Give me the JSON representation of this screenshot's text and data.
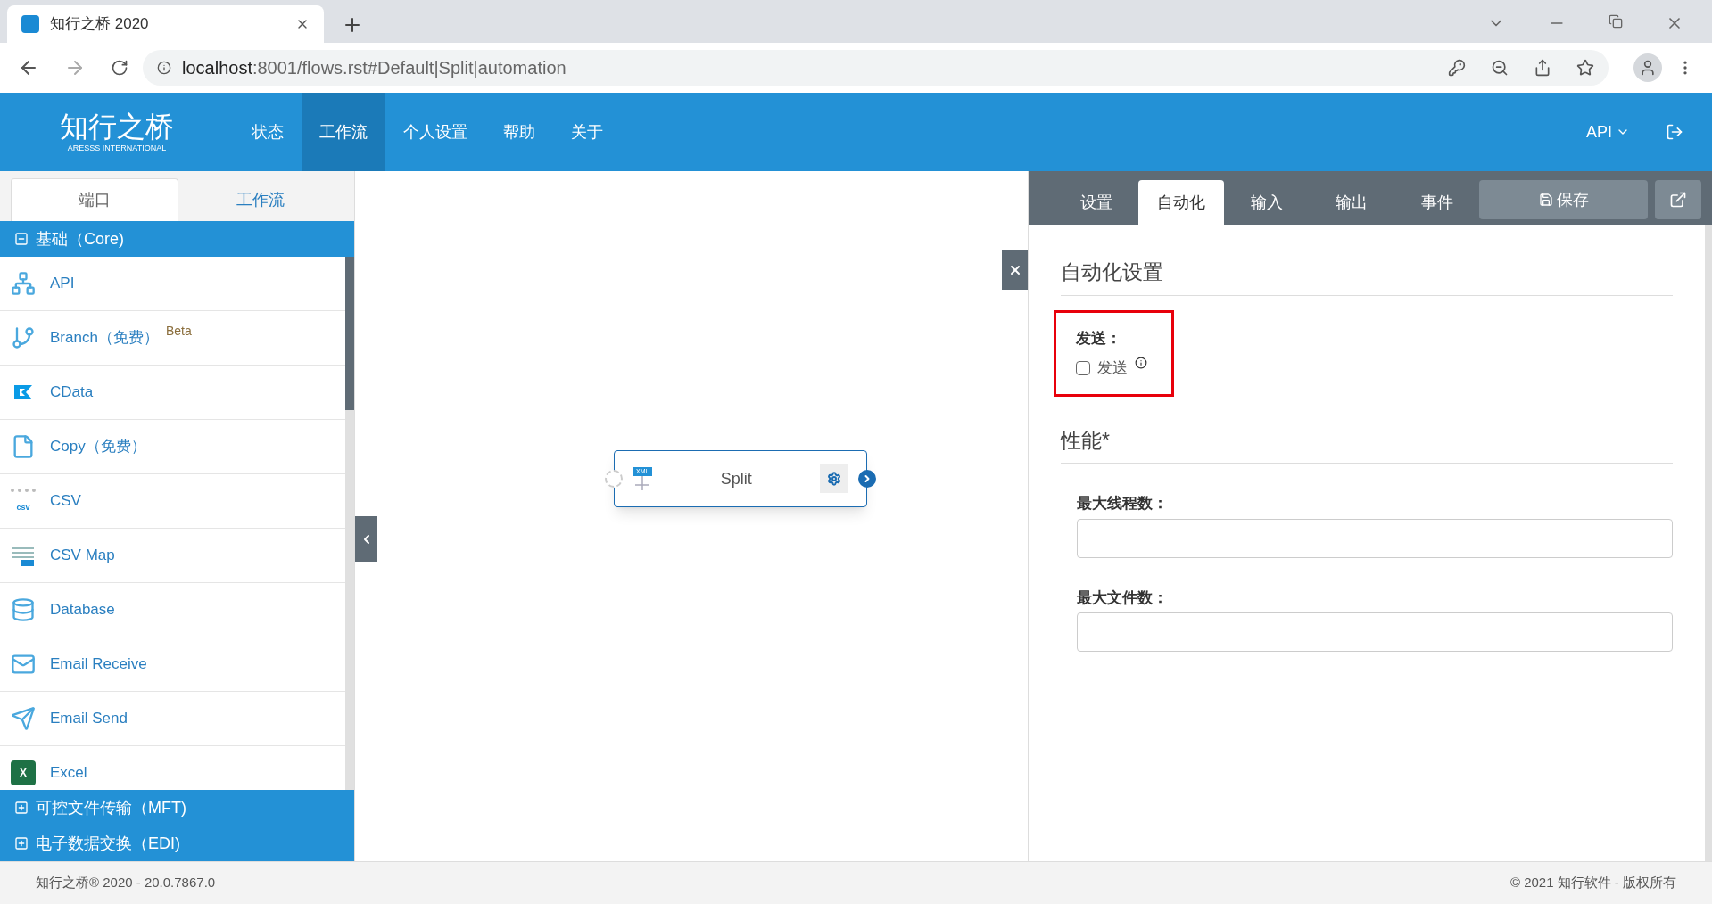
{
  "browser": {
    "tab_title": "知行之桥 2020",
    "url_host": "localhost",
    "url_rest": ":8001/flows.rst#Default|Split|automation"
  },
  "header": {
    "logo_text": "知行之桥",
    "logo_sub": "ARESSS INTERNATIONAL",
    "nav": [
      {
        "label": "状态",
        "selected": false
      },
      {
        "label": "工作流",
        "selected": true
      },
      {
        "label": "个人设置",
        "selected": false
      },
      {
        "label": "帮助",
        "selected": false
      },
      {
        "label": "关于",
        "selected": false
      }
    ],
    "api_menu": "API"
  },
  "sidebar": {
    "tabs": [
      {
        "label": "端口",
        "selected": true
      },
      {
        "label": "工作流",
        "selected": false
      }
    ],
    "groups": [
      {
        "title": "基础（Core)",
        "expanded": true,
        "items": [
          {
            "label": "API"
          },
          {
            "label": "Branch（免费）",
            "badge": "Beta"
          },
          {
            "label": "CData"
          },
          {
            "label": "Copy（免费）"
          },
          {
            "label": "CSV",
            "icon_text": "csv"
          },
          {
            "label": "CSV Map"
          },
          {
            "label": "Database"
          },
          {
            "label": "Email Receive"
          },
          {
            "label": "Email Send"
          },
          {
            "label": "Excel",
            "icon_text": "X"
          }
        ]
      },
      {
        "title": "可控文件传输（MFT)",
        "expanded": false
      },
      {
        "title": "电子数据交换（EDI)",
        "expanded": false
      }
    ]
  },
  "canvas": {
    "node": {
      "label": "Split",
      "icon_tag": "XML"
    }
  },
  "panel": {
    "tabs": [
      {
        "label": "设置",
        "selected": false
      },
      {
        "label": "自动化",
        "selected": true
      },
      {
        "label": "输入",
        "selected": false
      },
      {
        "label": "输出",
        "selected": false
      },
      {
        "label": "事件",
        "selected": false
      }
    ],
    "save_button": "保存",
    "sections": [
      {
        "title": "自动化设置",
        "fields": [
          {
            "kind": "checkbox",
            "label": "发送：",
            "option": "发送",
            "checked": false
          }
        ]
      },
      {
        "title": "性能*",
        "fields": [
          {
            "kind": "text",
            "label": "最大线程数："
          },
          {
            "kind": "text",
            "label": "最大文件数："
          }
        ]
      }
    ]
  },
  "footer": {
    "version": "知行之桥® 2020 - 20.0.7867.0",
    "copyright": "© 2021 知行软件 - 版权所有"
  }
}
